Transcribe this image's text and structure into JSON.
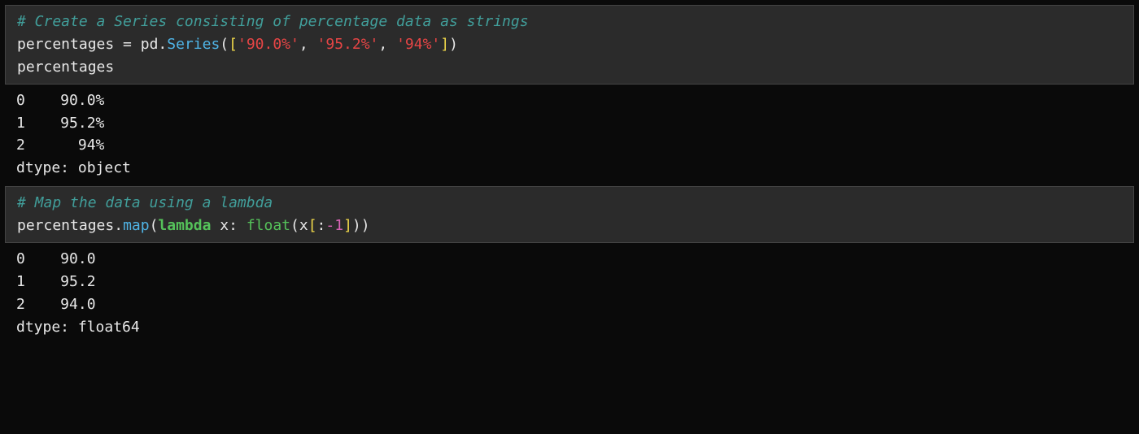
{
  "cells": [
    {
      "code": {
        "comment": "# Create a Series consisting of percentage data as strings",
        "var": "percentages",
        "assign": " = ",
        "mod": "pd",
        "dot1": ".",
        "series": "Series",
        "lp": "(",
        "lb": "[",
        "s1": "'90.0%'",
        "comma1": ", ",
        "s2": "'95.2%'",
        "comma2": ", ",
        "s3": "'94%'",
        "rb": "]",
        "rp": ")",
        "echo": "percentages"
      },
      "output": {
        "line0": "0    90.0%",
        "line1": "1    95.2%",
        "line2": "2      94%",
        "dtype": "dtype: object"
      }
    },
    {
      "code": {
        "comment": "# Map the data using a lambda",
        "var": "percentages",
        "dot1": ".",
        "map": "map",
        "lp": "(",
        "lambda": "lambda",
        "x": " x: ",
        "float": "float",
        "lp2": "(",
        "xs": "x",
        "lb": "[",
        "colon": ":",
        "neg": "-",
        "one": "1",
        "rb": "]",
        "rp2": ")",
        "rp": ")"
      },
      "output": {
        "line0": "0    90.0",
        "line1": "1    95.2",
        "line2": "2    94.0",
        "dtype": "dtype: float64"
      }
    }
  ]
}
